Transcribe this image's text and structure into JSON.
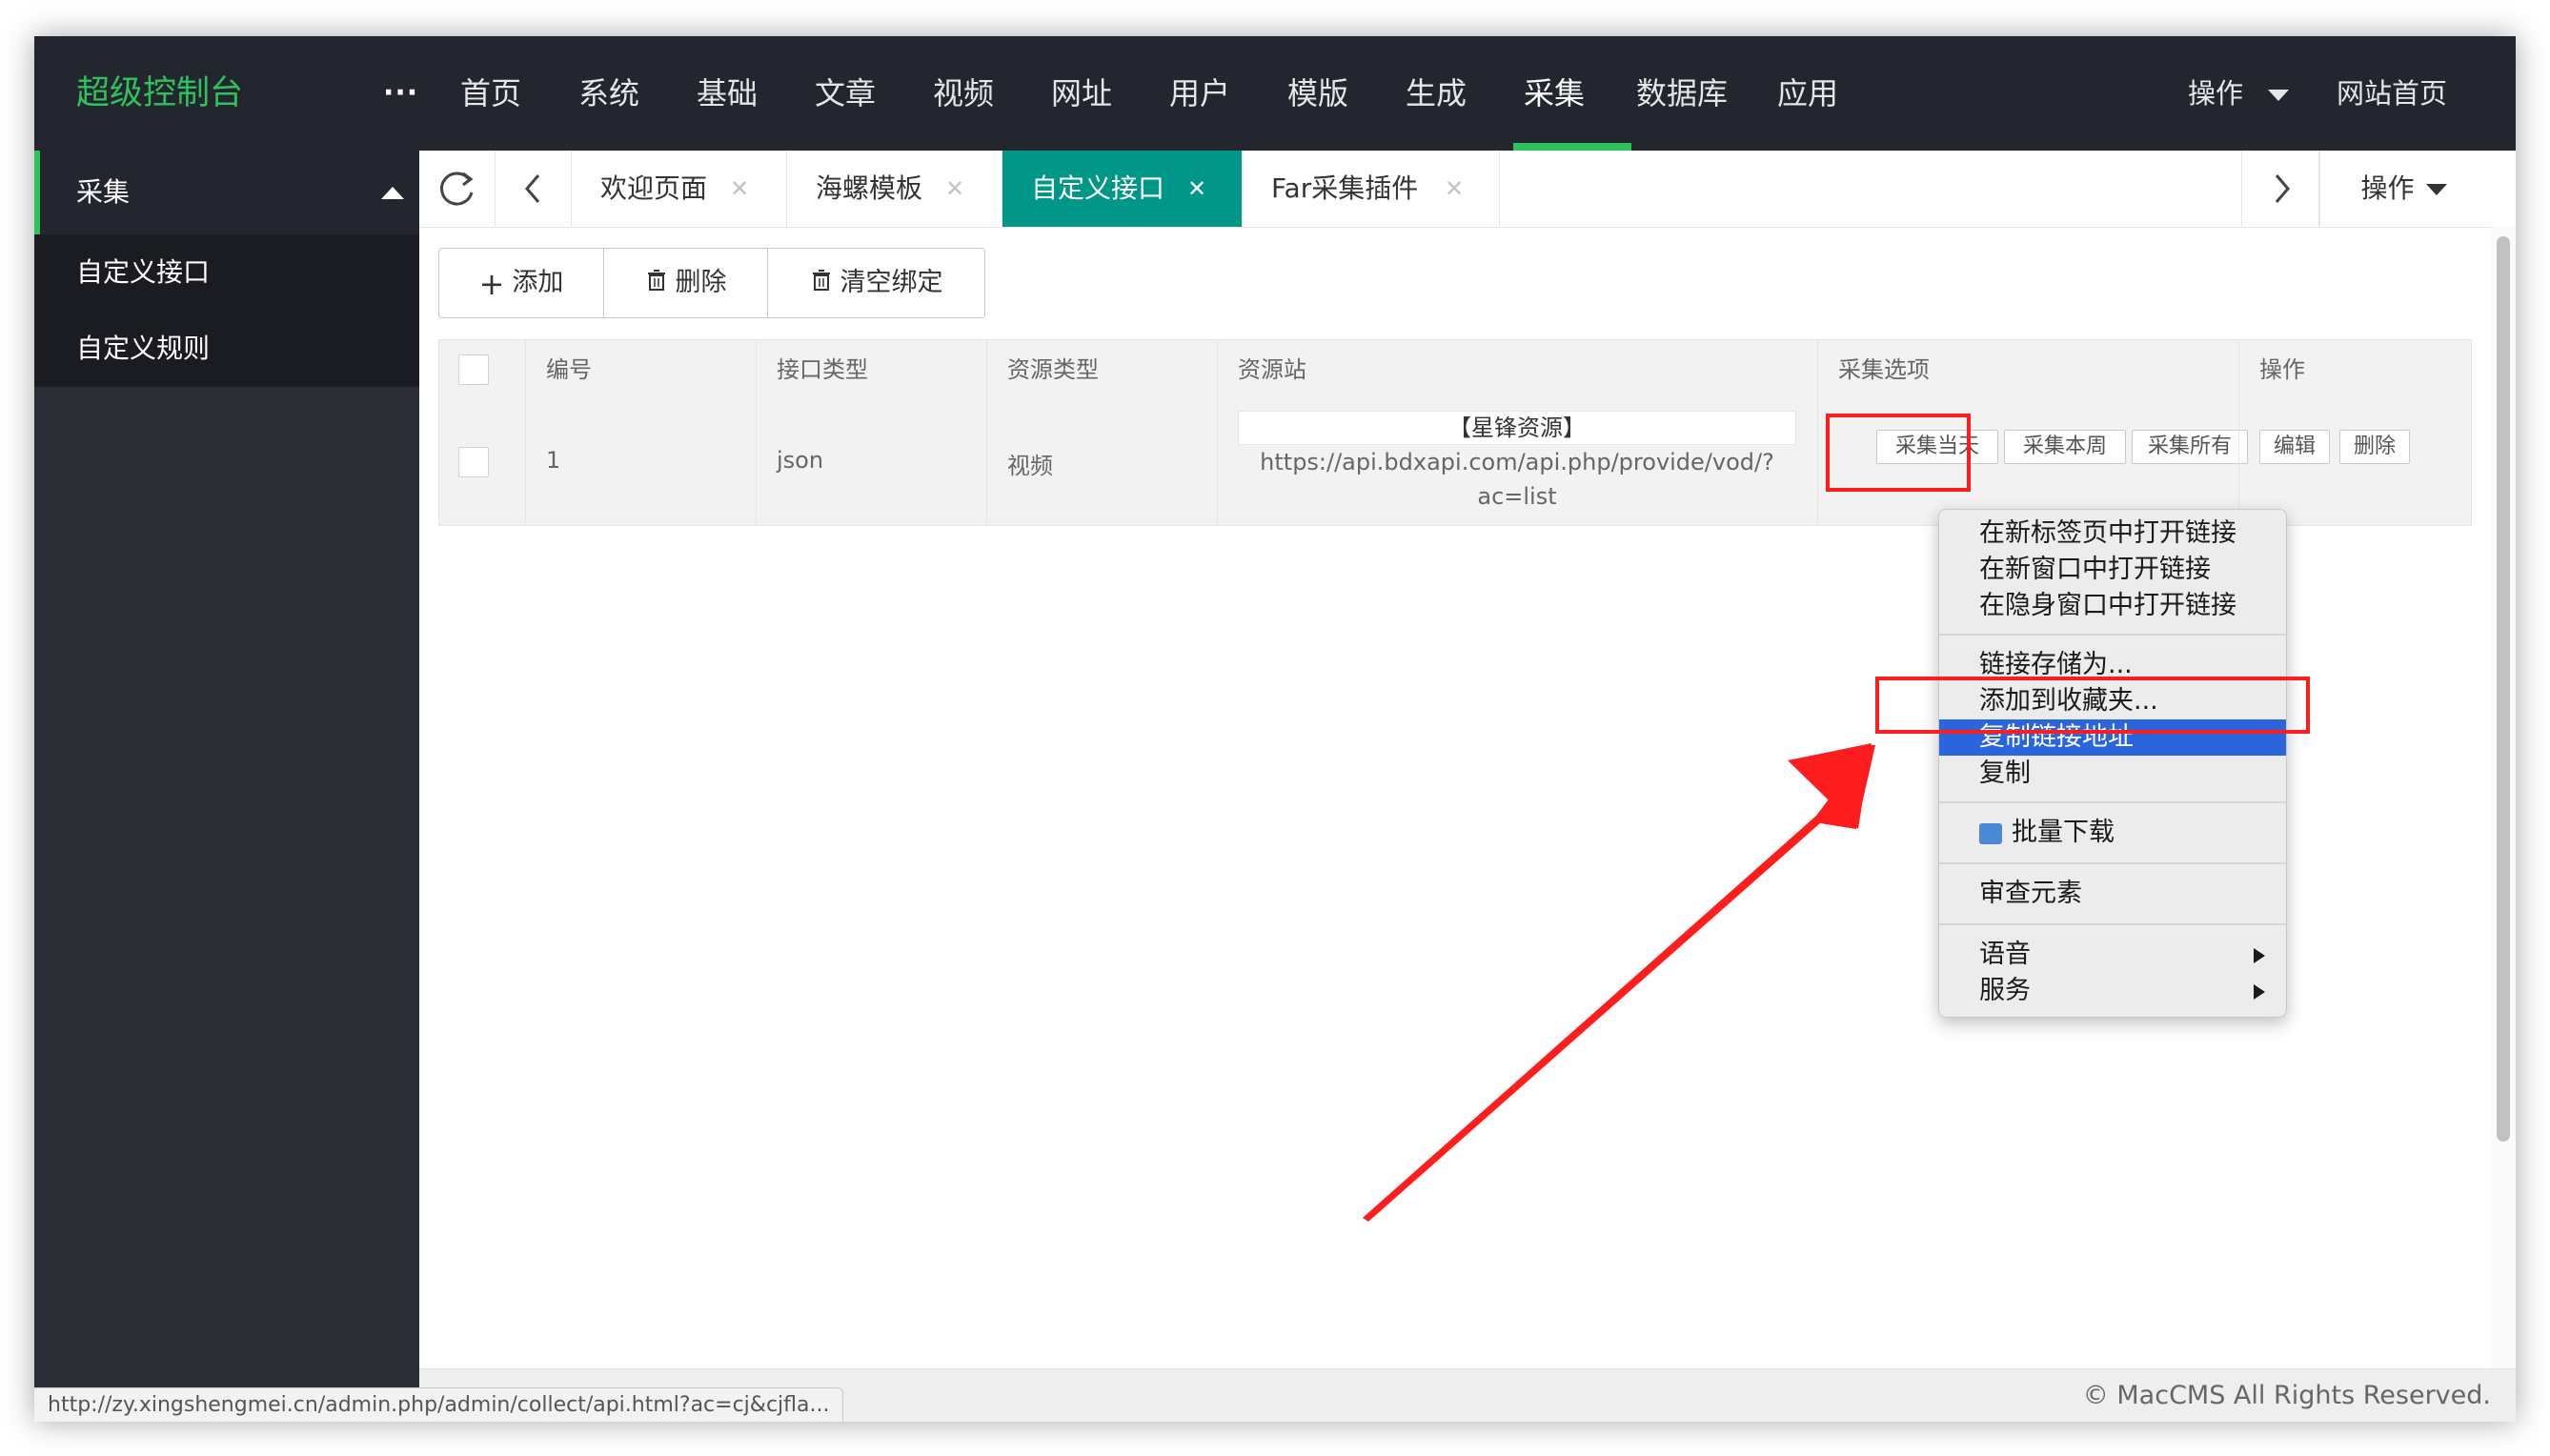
{
  "app": {
    "title": "超级控制台",
    "more": "···"
  },
  "nav": {
    "items": [
      {
        "label": "首页"
      },
      {
        "label": "系统"
      },
      {
        "label": "基础"
      },
      {
        "label": "文章"
      },
      {
        "label": "视频"
      },
      {
        "label": "网址"
      },
      {
        "label": "用户"
      },
      {
        "label": "模版"
      },
      {
        "label": "生成"
      },
      {
        "label": "采集"
      },
      {
        "label": "数据库"
      },
      {
        "label": "应用"
      }
    ],
    "active": "采集",
    "operate": "操作",
    "site_home": "网站首页"
  },
  "sidebar": {
    "section": "采集",
    "items": [
      {
        "label": "自定义接口"
      },
      {
        "label": "自定义规则"
      }
    ]
  },
  "tabs": {
    "items": [
      {
        "label": "欢迎页面"
      },
      {
        "label": "海螺模板"
      },
      {
        "label": "自定义接口",
        "active": true
      },
      {
        "label": "Far采集插件"
      }
    ],
    "operate": "操作"
  },
  "toolbar": {
    "add": "添加",
    "delete": "删除",
    "clear_binding": "清空绑定"
  },
  "table": {
    "headers": [
      "编号",
      "接口类型",
      "资源类型",
      "资源站",
      "采集选项",
      "操作"
    ],
    "rows": [
      {
        "id": "1",
        "api_type": "json",
        "resource_type": "视频",
        "source_name": "【星锋资源】",
        "source_url_line1": "https://api.bdxapi.com/api.php/provide/vod/?",
        "source_url_line2": "ac=list",
        "collect": [
          "采集当天",
          "采集本周",
          "采集所有"
        ],
        "actions": [
          "编辑",
          "删除"
        ]
      }
    ]
  },
  "context_menu": {
    "items": [
      "在新标签页中打开链接",
      "在新窗口中打开链接",
      "在隐身窗口中打开链接",
      "链接存储为...",
      "添加到收藏夹...",
      "复制链接地址",
      "复制",
      "批量下载",
      "审查元素",
      "语音",
      "服务"
    ],
    "highlighted": "复制链接地址",
    "highlight_color": "#2a65de"
  },
  "status_url": "http://zy.xingshengmei.cn/admin.php/admin/collect/api.html?ac=cj&cjfla...",
  "footer": {
    "copyright": "© MacCMS All Rights Reserved."
  },
  "colors": {
    "brand": "#2fc25b",
    "active_tab": "#009688",
    "topbar": "#23262e",
    "annotation": "#ff1d1d"
  }
}
